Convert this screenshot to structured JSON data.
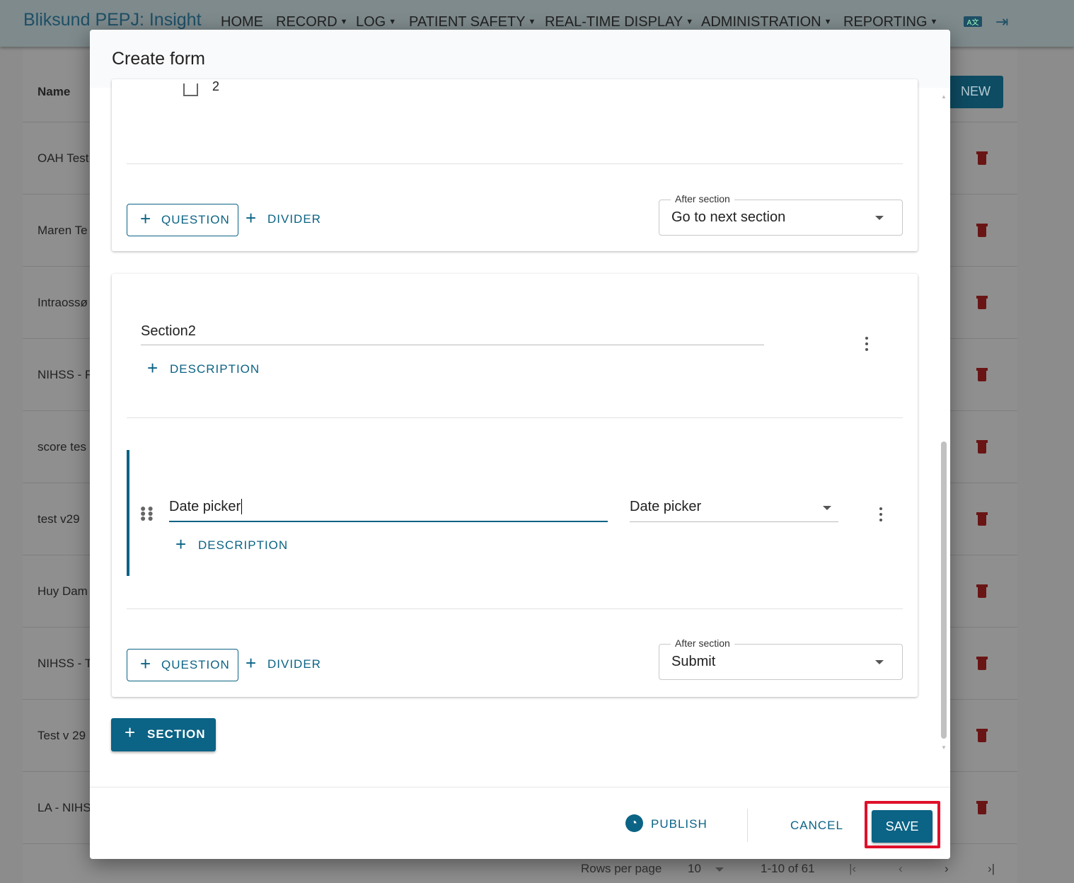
{
  "app": {
    "title": "Bliksund PEPJ: Insight",
    "nav": [
      {
        "label": "HOME",
        "dropdown": false
      },
      {
        "label": "RECORD",
        "dropdown": true
      },
      {
        "label": "LOG",
        "dropdown": true
      },
      {
        "label": "PATIENT SAFETY",
        "dropdown": true
      },
      {
        "label": "REAL-TIME DISPLAY",
        "dropdown": true
      },
      {
        "label": "ADMINISTRATION",
        "dropdown": true
      },
      {
        "label": "REPORTING",
        "dropdown": true
      }
    ],
    "icons": [
      "translate-icon",
      "logout-icon"
    ]
  },
  "background": {
    "column_header": "Name",
    "new_label": "NEW",
    "rows": [
      "OAH Test",
      "Maren Te",
      "Intraossø",
      "NIHSS - F",
      "score tes",
      "test v29",
      "Huy Dam",
      "NIHSS - T",
      "Test v 29",
      "LA - NIHS"
    ],
    "pagination": {
      "rows_per_page_label": "Rows per page",
      "rows_per_page": "10",
      "range": "1-10 of 61"
    }
  },
  "modal": {
    "title": "Create form",
    "section1": {
      "partial_option": "2",
      "question_label": "QUESTION",
      "divider_label": "DIVIDER",
      "after_section_label": "After section",
      "after_section_value": "Go to next section"
    },
    "section2": {
      "title": "Section2",
      "description_label": "DESCRIPTION",
      "question": {
        "title": "Date picker",
        "type": "Date picker",
        "description_label": "DESCRIPTION"
      },
      "question_label": "QUESTION",
      "divider_label": "DIVIDER",
      "after_section_label": "After section",
      "after_section_value": "Submit"
    },
    "add_section_label": "SECTION",
    "footer": {
      "publish": "PUBLISH",
      "cancel": "CANCEL",
      "save": "SAVE"
    }
  },
  "colors": {
    "primary": "#0b6385",
    "highlight": "#e0102a",
    "trash": "#6a1515"
  }
}
